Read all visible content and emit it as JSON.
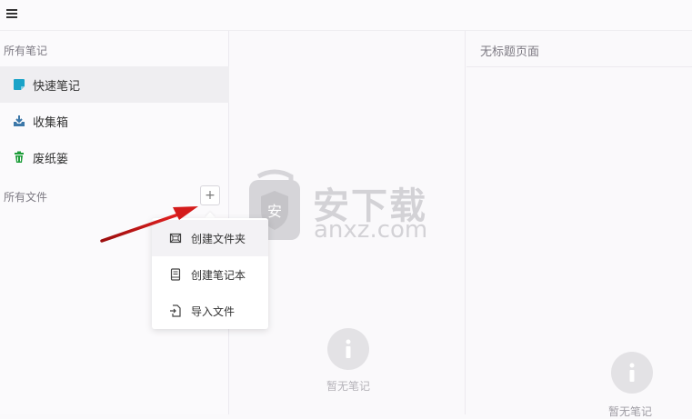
{
  "toolbar": {
    "menu_icon": "hamburger-icon"
  },
  "sidebar": {
    "all_notes_label": "所有笔记",
    "items": [
      {
        "label": "快速笔记",
        "icon": "quick-note-icon",
        "color": "#1aa3c8"
      },
      {
        "label": "收集箱",
        "icon": "inbox-download-icon",
        "color": "#3d78a9"
      },
      {
        "label": "废纸篓",
        "icon": "trash-icon",
        "color": "#1e9d3a"
      }
    ],
    "all_files_label": "所有文件",
    "add_button_label": "+"
  },
  "context_menu": {
    "items": [
      {
        "label": "创建文件夹",
        "icon": "create-folder-icon"
      },
      {
        "label": "创建笔记本",
        "icon": "create-notebook-icon"
      },
      {
        "label": "导入文件",
        "icon": "import-file-icon"
      }
    ]
  },
  "middle_panel": {
    "empty_text": "暂无笔记"
  },
  "right_panel": {
    "title": "无标题页面",
    "empty_text": "暂无笔记"
  },
  "watermark": {
    "brand_text": "安下载",
    "domain_text": "anxz.com"
  }
}
